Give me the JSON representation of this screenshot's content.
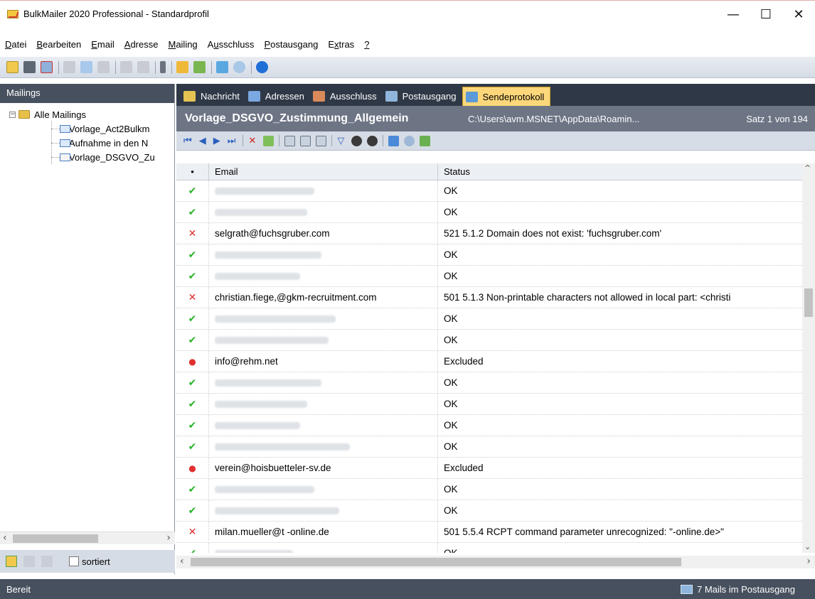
{
  "window": {
    "title": "BulkMailer 2020 Professional - Standardprofil",
    "controls": [
      "—",
      "☐",
      "✕"
    ]
  },
  "menu": [
    {
      "pre": "",
      "ul": "D",
      "post": "atei"
    },
    {
      "pre": "",
      "ul": "B",
      "post": "earbeiten"
    },
    {
      "pre": "",
      "ul": "E",
      "post": "mail"
    },
    {
      "pre": "",
      "ul": "A",
      "post": "dresse"
    },
    {
      "pre": "",
      "ul": "M",
      "post": "ailing"
    },
    {
      "pre": "A",
      "ul": "u",
      "post": "sschluss"
    },
    {
      "pre": "",
      "ul": "P",
      "post": "ostausgang"
    },
    {
      "pre": "E",
      "ul": "x",
      "post": "tras"
    },
    {
      "pre": "",
      "ul": "?",
      "post": ""
    }
  ],
  "left_panel": {
    "header": "Mailings",
    "root": "Alle Mailings",
    "items": [
      "Vorlage_Act2Bulkm",
      "Aufnahme in den N",
      "Vorlage_DSGVO_Zu"
    ],
    "sort_label": "sortiert"
  },
  "tabs": [
    "Nachricht",
    "Adressen",
    "Ausschluss",
    "Postausgang",
    "Sendeprotokoll"
  ],
  "active_tab": "Sendeprotokoll",
  "record": {
    "title": "Vorlage_DSGVO_Zustimmung_Allgemein",
    "path": "C:\\Users\\avm.MSNET\\AppData\\Roamin...",
    "count": "Satz 1 von 194"
  },
  "grid": {
    "columns": [
      "•",
      "Email",
      "Status"
    ],
    "rows": [
      {
        "mark": "ok",
        "email": "",
        "status": "OK"
      },
      {
        "mark": "ok",
        "email": "",
        "status": "OK"
      },
      {
        "mark": "err",
        "email": "selgrath@fuchsgruber.com",
        "status": "521 5.1.2 Domain does not exist: 'fuchsgruber.com'"
      },
      {
        "mark": "ok",
        "email": "",
        "status": "OK"
      },
      {
        "mark": "ok",
        "email": "",
        "status": "OK"
      },
      {
        "mark": "err",
        "email": "christian.fiege,@gkm-recruitment.com",
        "status": "501 5.1.3 Non-printable characters not allowed in local part: <christi"
      },
      {
        "mark": "ok",
        "email": "",
        "status": "OK"
      },
      {
        "mark": "ok",
        "email": "",
        "status": "OK"
      },
      {
        "mark": "dot",
        "email": "info@rehm.net",
        "status": "Excluded"
      },
      {
        "mark": "ok",
        "email": "",
        "status": "OK"
      },
      {
        "mark": "ok",
        "email": "",
        "status": "OK"
      },
      {
        "mark": "ok",
        "email": "",
        "status": "OK"
      },
      {
        "mark": "ok",
        "email": "",
        "status": "OK"
      },
      {
        "mark": "dot",
        "email": "verein@hoisbuetteler-sv.de",
        "status": "Excluded"
      },
      {
        "mark": "ok",
        "email": "",
        "status": "OK"
      },
      {
        "mark": "ok",
        "email": "",
        "status": "OK"
      },
      {
        "mark": "err",
        "email": "milan.mueller@t -online.de",
        "status": "501 5.5.4 RCPT command parameter unrecognized: \"-online.de>\""
      },
      {
        "mark": "ok",
        "email": "",
        "status": "OK"
      }
    ]
  },
  "statusbar": {
    "left": "Bereit",
    "right": "7 Mails im Postausgang"
  },
  "colors": {
    "ok": "#2bb52b",
    "error": "#e03030",
    "active_tab": "#fdd77a",
    "header_dark": "#47505e"
  }
}
